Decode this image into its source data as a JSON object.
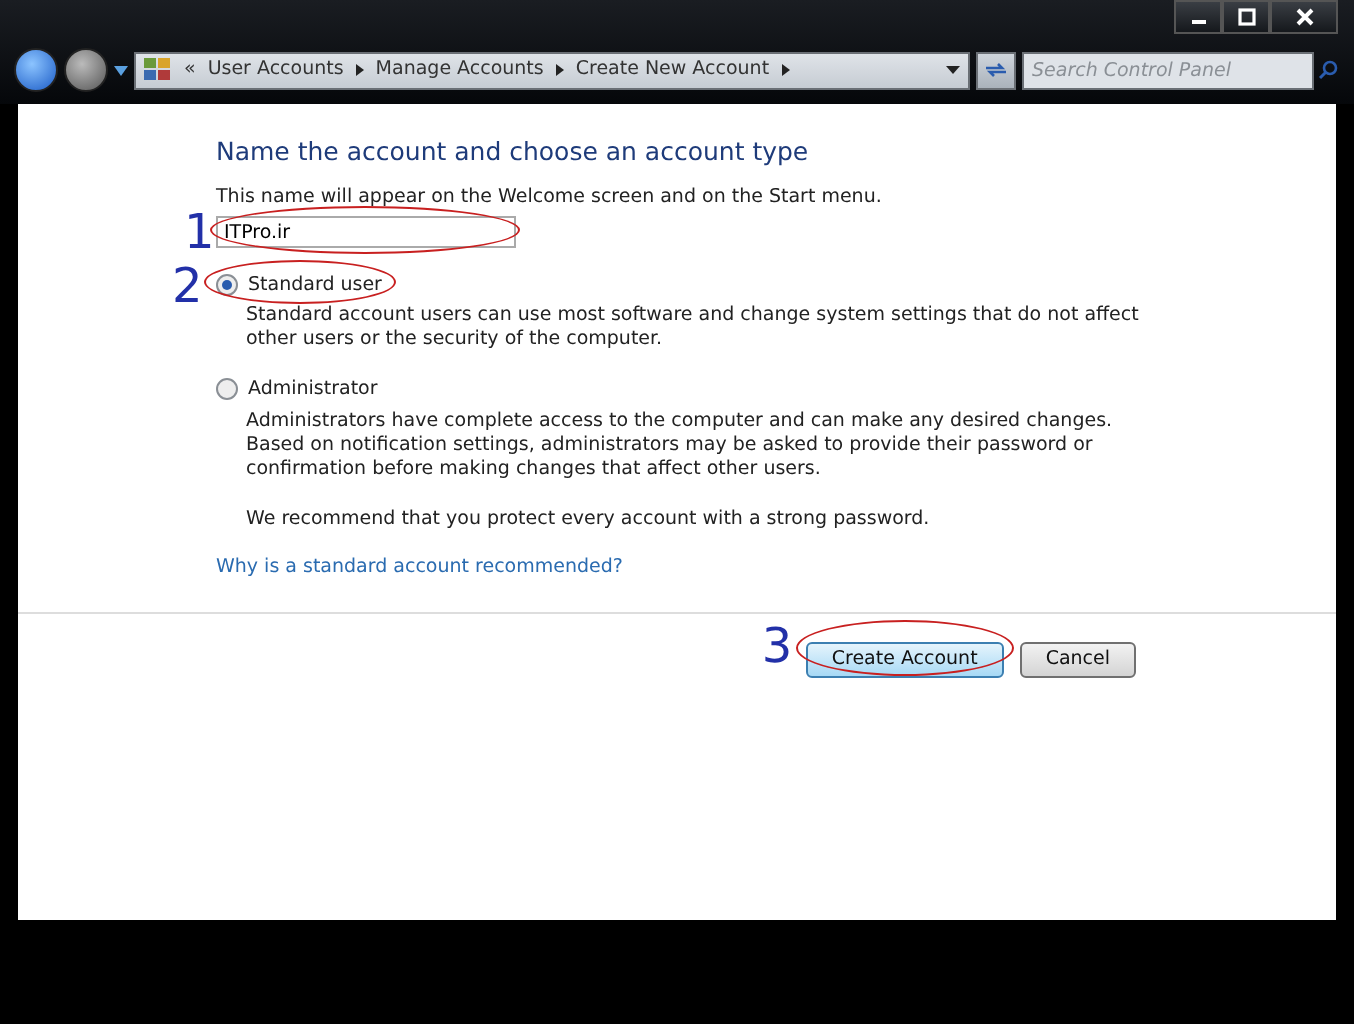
{
  "address_bar": {
    "overflow": "«",
    "crumbs": [
      "User Accounts",
      "Manage Accounts",
      "Create New Account"
    ]
  },
  "search": {
    "placeholder": "Search Control Panel"
  },
  "heading": "Name the account and choose an account type",
  "name_hint": "This name will appear on the Welcome screen and on the Start menu.",
  "name_field": {
    "value": "ITPro.ir",
    "step": "1"
  },
  "account_types": [
    {
      "label": "Standard user",
      "selected": true,
      "description": "Standard account users can use most software and change system settings that do not affect other users or the security of the computer.",
      "step": "2"
    },
    {
      "label": "Administrator",
      "selected": false,
      "description": "Administrators have complete access to the computer and can make any desired changes. Based on notification settings, administrators may be asked to provide their password or confirmation before making changes that affect other users."
    }
  ],
  "recommendation": "We recommend that you protect every account with a strong password.",
  "help_link": "Why is a standard account recommended?",
  "buttons": [
    {
      "label": "Create Account",
      "kind": "primary",
      "step": "3"
    },
    {
      "label": "Cancel",
      "kind": "secondary"
    }
  ]
}
